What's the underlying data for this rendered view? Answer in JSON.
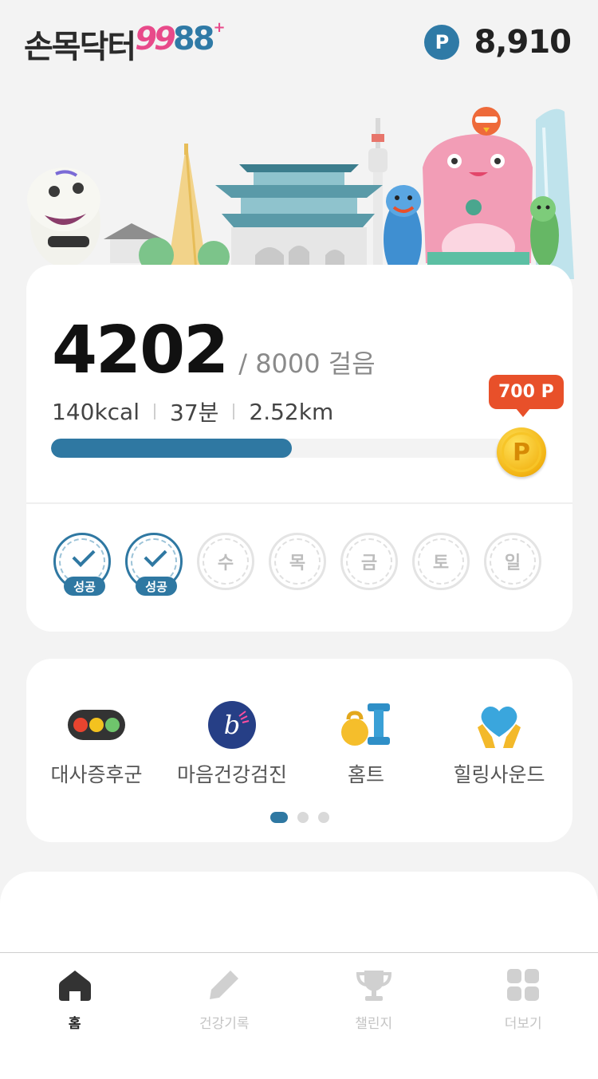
{
  "header": {
    "logo_korean": "손목닥터",
    "logo_99": "99",
    "logo_88": "88",
    "logo_plus": "+",
    "points_badge": "P",
    "points_value": "8,910"
  },
  "steps": {
    "count": "4202",
    "goal_text": "/ 8000 걸음",
    "kcal": "140kcal",
    "minutes": "37분",
    "distance": "2.52km",
    "progress_fraction": 0.53,
    "reward_label": "700 P",
    "coin_symbol": "P"
  },
  "week": {
    "success_label": "성공",
    "days": [
      {
        "label": "",
        "status": "success"
      },
      {
        "label": "",
        "status": "success"
      },
      {
        "label": "수",
        "status": "pending"
      },
      {
        "label": "목",
        "status": "pending"
      },
      {
        "label": "금",
        "status": "pending"
      },
      {
        "label": "토",
        "status": "pending"
      },
      {
        "label": "일",
        "status": "pending"
      }
    ]
  },
  "services": {
    "items": [
      {
        "label": "대사증후군",
        "icon": "traffic-light-icon"
      },
      {
        "label": "마음건강검진",
        "icon": "mind-check-icon"
      },
      {
        "label": "홈트",
        "icon": "kettlebell-dumbbell-icon"
      },
      {
        "label": "힐링사운드",
        "icon": "heart-hands-icon"
      }
    ],
    "page_count": 3,
    "active_page": 1
  },
  "tabbar": {
    "tabs": [
      {
        "label": "홈",
        "icon": "home-icon",
        "active": true
      },
      {
        "label": "건강기록",
        "icon": "pencil-icon",
        "active": false
      },
      {
        "label": "챌린지",
        "icon": "trophy-icon",
        "active": false
      },
      {
        "label": "더보기",
        "icon": "grid-icon",
        "active": false
      }
    ]
  },
  "colors": {
    "accent": "#2f78a2",
    "reward": "#e8502a",
    "logo_pink": "#e84a8a"
  }
}
